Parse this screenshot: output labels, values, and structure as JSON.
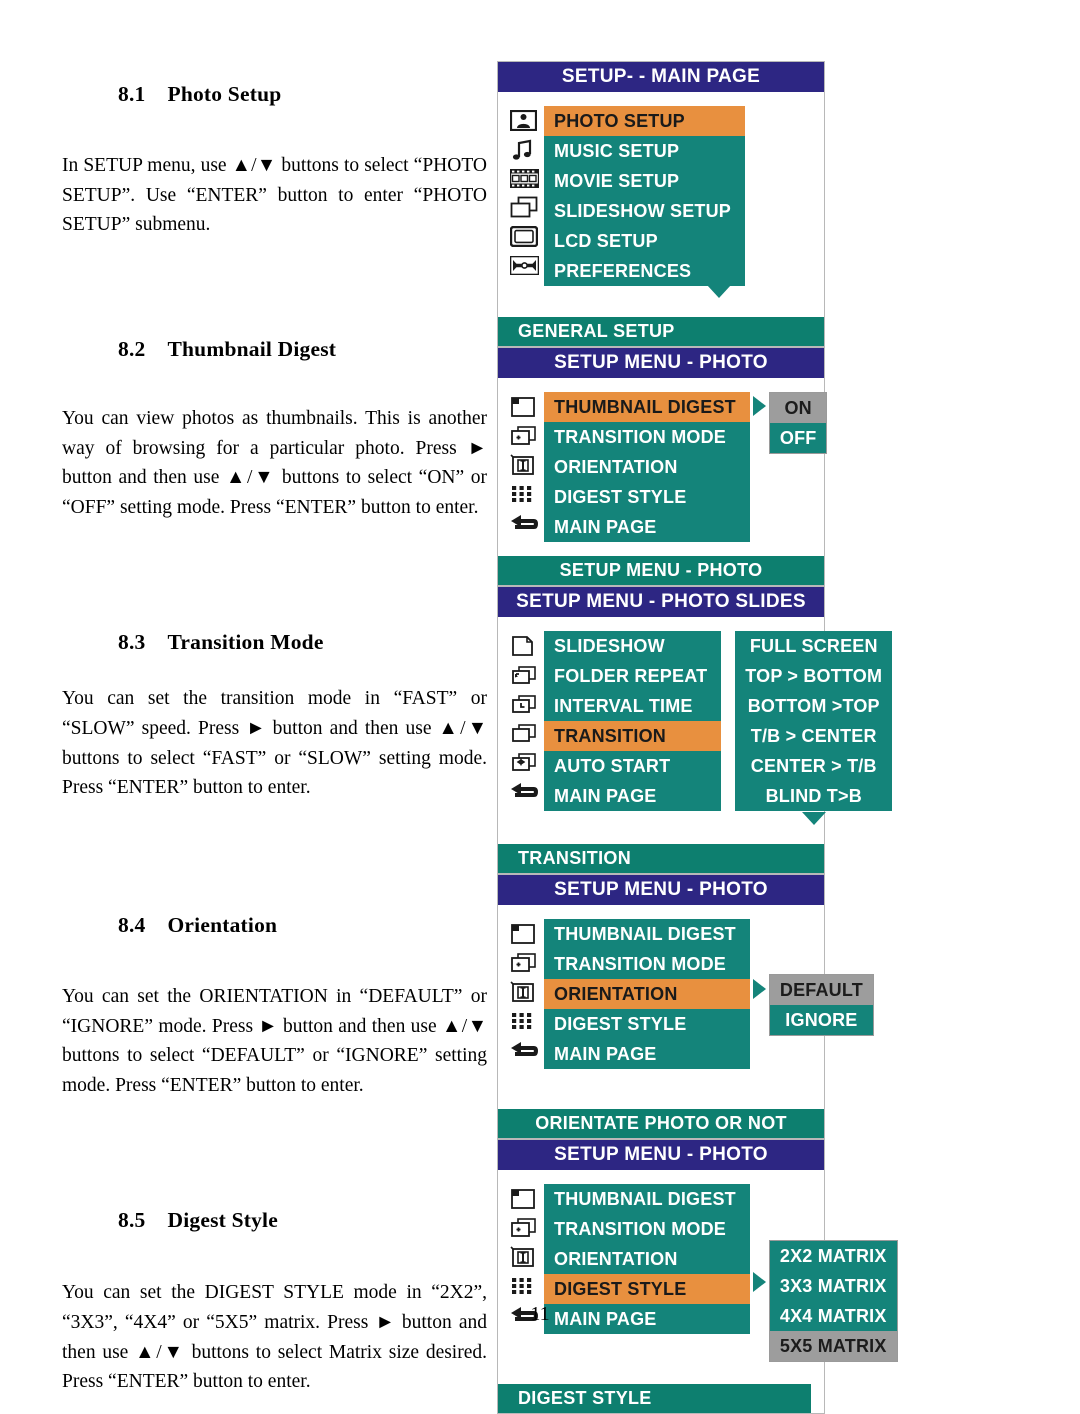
{
  "page": {
    "number": "11"
  },
  "sections": [
    {
      "id": "photo-setup",
      "number": "8.1",
      "title": "Photo Setup",
      "body": "In SETUP menu, use ▲/▼ buttons to select “PHOTO SETUP”. Use “ENTER” button to enter “PHOTO SETUP” submenu."
    },
    {
      "id": "thumbnail-digest",
      "number": "8.2",
      "title": "Thumbnail Digest",
      "body": "You can view photos as thumbnails. This is another way of browsing for a particular photo. Press ► button and then use ▲/▼ buttons to select “ON” or “OFF” setting mode. Press “ENTER” button to enter."
    },
    {
      "id": "transition-mode",
      "number": "8.3",
      "title": "Transition Mode",
      "body": "You can set the transition mode in “FAST” or “SLOW” speed. Press ► button and then use ▲/▼ buttons to select “FAST” or “SLOW” setting mode. Press “ENTER” button to enter."
    },
    {
      "id": "orientation",
      "number": "8.4",
      "title": "Orientation",
      "body": "You can set the ORIENTATION in “DEFAULT” or “IGNORE” mode. Press ► button and then use ▲/▼ buttons to select “DEFAULT” or “IGNORE” setting mode. Press “ENTER” button to enter."
    },
    {
      "id": "digest-style",
      "number": "8.5",
      "title": "Digest Style",
      "body": "You can set the DIGEST STYLE mode in “2X2”, “3X3”, “4X4” or “5X5” matrix. Press ► button and then use ▲/▼ buttons to select Matrix size desired. Press “ENTER” button to enter."
    }
  ],
  "colors": {
    "title_bar": "#2d2683",
    "hint_bar": "#0d7f6f",
    "menu_bg": "#14847a",
    "highlight": "#e8903f",
    "value_selected": "#9d9d9d",
    "text_light": "#ffffff"
  },
  "screens": [
    {
      "id": "setup-main-page",
      "title": "SETUP- - MAIN PAGE",
      "icons": [
        "photo-icon",
        "music-note-icon",
        "film-strip-icon",
        "slideshow-icon",
        "lcd-screen-icon",
        "wrench-icon"
      ],
      "items": [
        {
          "label": "PHOTO SETUP",
          "selected": true
        },
        {
          "label": "MUSIC SETUP",
          "selected": false
        },
        {
          "label": "MOVIE SETUP",
          "selected": false
        },
        {
          "label": "SLIDESHOW SETUP",
          "selected": false
        },
        {
          "label": "LCD SETUP",
          "selected": false
        },
        {
          "label": "PREFERENCES",
          "selected": false
        }
      ],
      "has_down_arrow": true,
      "hint": "GENERAL SETUP"
    },
    {
      "id": "setup-menu-photo-thumbnail",
      "title": "SETUP MENU - PHOTO",
      "icons": [
        "thumbnail-icon",
        "transition-icon",
        "orientation-icon",
        "matrix-icon",
        "back-arrow-icon"
      ],
      "items": [
        {
          "label": "THUMBNAIL DIGEST",
          "selected": true
        },
        {
          "label": "TRANSITION MODE",
          "selected": false
        },
        {
          "label": "ORIENTATION",
          "selected": false
        },
        {
          "label": "DIGEST STYLE",
          "selected": false
        },
        {
          "label": "MAIN PAGE",
          "selected": false
        }
      ],
      "values": [
        {
          "label": "ON",
          "selected": true
        },
        {
          "label": "OFF",
          "selected": false
        }
      ],
      "hint": "SETUP MENU - PHOTO"
    },
    {
      "id": "setup-menu-photo-slides",
      "title": "SETUP MENU - PHOTO SLIDES",
      "icons": [
        "slide-icon",
        "folder-repeat-icon",
        "interval-time-icon",
        "transition-stack-icon",
        "auto-start-icon",
        "back-arrow-icon"
      ],
      "items": [
        {
          "label": "SLIDESHOW",
          "selected": false
        },
        {
          "label": "FOLDER REPEAT",
          "selected": false
        },
        {
          "label": "INTERVAL TIME",
          "selected": false
        },
        {
          "label": "TRANSITION",
          "selected": true
        },
        {
          "label": "AUTO START",
          "selected": false
        },
        {
          "label": "MAIN PAGE",
          "selected": false
        }
      ],
      "values": [
        {
          "label": "FULL SCREEN",
          "selected": false
        },
        {
          "label": "TOP > BOTTOM",
          "selected": false
        },
        {
          "label": "BOTTOM >TOP",
          "selected": false
        },
        {
          "label": "T/B > CENTER",
          "selected": false
        },
        {
          "label": "CENTER > T/B",
          "selected": false
        },
        {
          "label": "BLIND T>B",
          "selected": false
        }
      ],
      "values_down_arrow": true,
      "hint": "TRANSITION"
    },
    {
      "id": "setup-menu-photo-orientation",
      "title": "SETUP MENU - PHOTO",
      "icons": [
        "thumbnail-icon",
        "transition-icon",
        "orientation-icon",
        "matrix-icon",
        "back-arrow-icon"
      ],
      "items": [
        {
          "label": "THUMBNAIL DIGEST",
          "selected": false
        },
        {
          "label": "TRANSITION MODE",
          "selected": false
        },
        {
          "label": "ORIENTATION",
          "selected": true
        },
        {
          "label": "DIGEST STYLE",
          "selected": false
        },
        {
          "label": "MAIN PAGE",
          "selected": false
        }
      ],
      "values": [
        {
          "label": "DEFAULT",
          "selected": true
        },
        {
          "label": "IGNORE",
          "selected": false
        }
      ],
      "hint": "ORIENTATE PHOTO OR NOT"
    },
    {
      "id": "setup-menu-photo-digest-style",
      "title": "SETUP MENU - PHOTO",
      "icons": [
        "thumbnail-icon",
        "transition-icon",
        "orientation-icon",
        "matrix-icon",
        "back-arrow-icon"
      ],
      "items": [
        {
          "label": "THUMBNAIL DIGEST",
          "selected": false
        },
        {
          "label": "TRANSITION MODE",
          "selected": false
        },
        {
          "label": "ORIENTATION",
          "selected": false
        },
        {
          "label": "DIGEST STYLE",
          "selected": true
        },
        {
          "label": "MAIN PAGE",
          "selected": false
        }
      ],
      "values": [
        {
          "label": "2X2 MATRIX",
          "selected": false
        },
        {
          "label": "3X3 MATRIX",
          "selected": false
        },
        {
          "label": "4X4 MATRIX",
          "selected": false
        },
        {
          "label": "5X5 MATRIX",
          "selected": true
        }
      ],
      "hint": "DIGEST STYLE"
    }
  ]
}
